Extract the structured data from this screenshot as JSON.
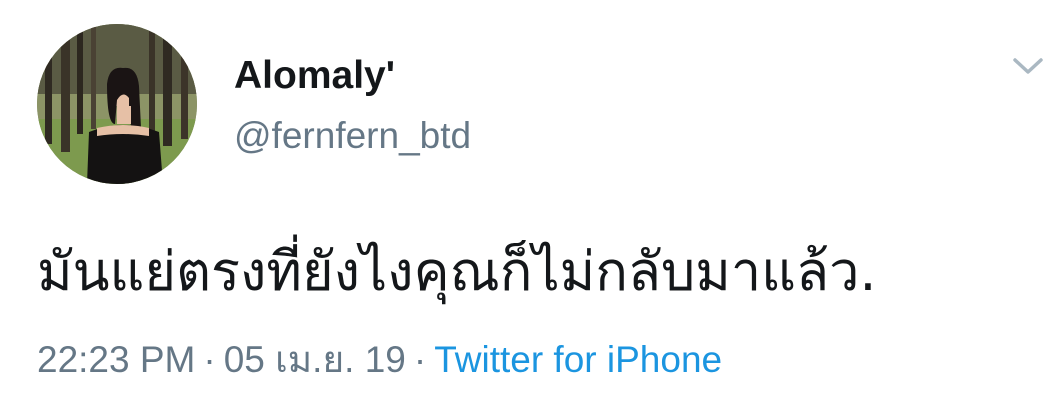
{
  "tweet": {
    "display_name": "Alomaly'",
    "handle": "@fernfern_btd",
    "text": "มันแย่ตรงที่ยังไงคุณก็ไม่กลับมาแล้ว.",
    "time": "22:23 PM",
    "separator": "·",
    "date": "05 เม.ย. 19",
    "source": "Twitter for iPhone",
    "menu_icon": "chevron-down-icon"
  },
  "colors": {
    "text_primary": "#14171a",
    "text_secondary": "#657786",
    "link": "#1b95e0",
    "caret": "#aab8c2"
  }
}
